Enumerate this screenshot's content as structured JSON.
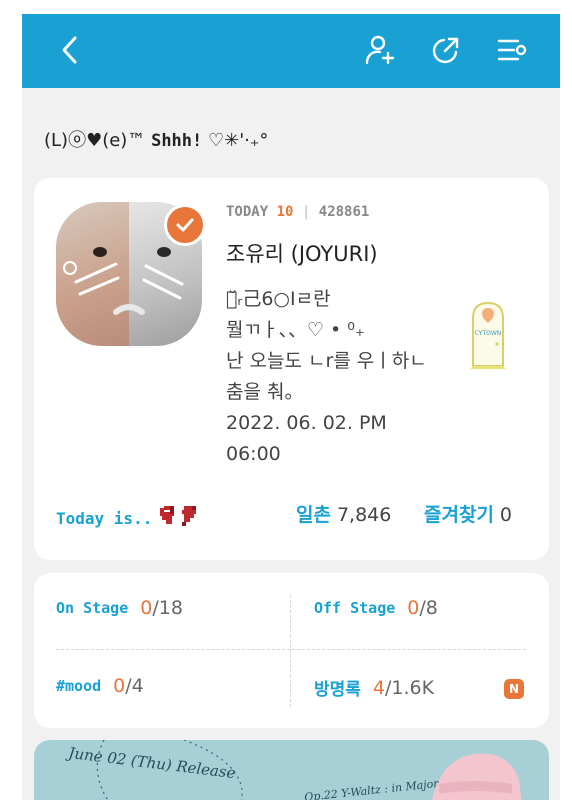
{
  "topbar": {
    "back_icon": "chevron-left-icon",
    "add_friend_icon": "person-add-icon",
    "share_icon": "share-icon",
    "menu_icon": "menu-settings-icon",
    "color": "#1aa1d3"
  },
  "tagline": {
    "prefix": "(L)ⓞ♥(e)™",
    "shh": "Shhh!",
    "suffix": "♡✳'·₊°"
  },
  "profile": {
    "today_label": "TODAY",
    "today_count": "10",
    "separator": "|",
    "total_count": "428861",
    "name": "조유리 (JOYURI)",
    "bio_lines": [
      "ﾊ̆ᵣ己6○Iㄹ란",
      "뭘ㄲㅏ、、♡ • ⁰₊",
      "난 오늘도 ㄴr를 우ㅣ하ㄴ",
      "춤을 춰。",
      "2022. 06. 02. PM",
      "06:00"
    ],
    "verified_icon": "check-badge-icon",
    "mini_room_icon": "cytown-door-icon",
    "mini_room_label": "CYTOWN"
  },
  "status": {
    "today_is_label": "Today is..",
    "mood_icon": "broken-heart-icon",
    "ilchon_label": "일촌",
    "ilchon_count": "7,846",
    "favorites_label": "즐겨찾기",
    "favorites_count": "0"
  },
  "counts": {
    "on_stage": {
      "label": "On Stage",
      "current": "0",
      "total": "/18"
    },
    "off_stage": {
      "label": "Off Stage",
      "current": "0",
      "total": "/8"
    },
    "mood": {
      "label": "#mood",
      "current": "0",
      "total": "/4"
    },
    "guestbook": {
      "label": "방명록",
      "current": "4",
      "total": "/1.6K",
      "new_badge": "N"
    }
  },
  "banner": {
    "date_text": "June 02 (Thu) Release",
    "sub_text": "Op.22 Y-Waltz : in Major"
  },
  "colors": {
    "accent": "#e8763b",
    "brand": "#1aa1d3"
  }
}
